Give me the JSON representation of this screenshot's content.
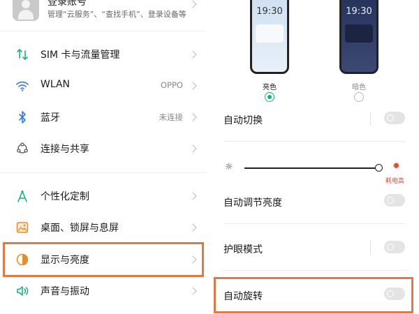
{
  "left": {
    "account": {
      "title": "登录账号",
      "subtitle": "管理“云服务”、“查找手机”、登录设备等"
    },
    "items": [
      {
        "label": "SIM 卡与流量管理",
        "icon": "sim-icon",
        "value": ""
      },
      {
        "label": "WLAN",
        "icon": "wifi-icon",
        "value": "OPPO"
      },
      {
        "label": "蓝牙",
        "icon": "bluetooth-icon",
        "value": "未连接"
      },
      {
        "label": "连接与共享",
        "icon": "share-icon",
        "value": ""
      },
      {
        "label": "个性化定制",
        "icon": "compass-icon",
        "value": ""
      },
      {
        "label": "桌面、锁屏与息屏",
        "icon": "wallpaper-icon",
        "value": ""
      },
      {
        "label": "显示与亮度",
        "icon": "display-icon",
        "value": ""
      },
      {
        "label": "声音与振动",
        "icon": "sound-icon",
        "value": ""
      }
    ]
  },
  "right": {
    "modes": {
      "light_time": "19:30",
      "dark_time": "19:30",
      "light_label": "亮色",
      "dark_label": "暗色",
      "selected": "light"
    },
    "auto_switch": {
      "label": "自动切换",
      "on": false
    },
    "brightness": {
      "level": 0.97,
      "hint": "耗电高"
    },
    "auto_brightness": {
      "label": "自动调节亮度",
      "on": false
    },
    "eye_care": {
      "label": "护眼模式",
      "on": false
    },
    "auto_rotate": {
      "label": "自动旋转",
      "on": false
    }
  },
  "colors": {
    "highlight": "#e07a43",
    "accent_green": "#1ab176",
    "warning_red": "#e8452c"
  }
}
